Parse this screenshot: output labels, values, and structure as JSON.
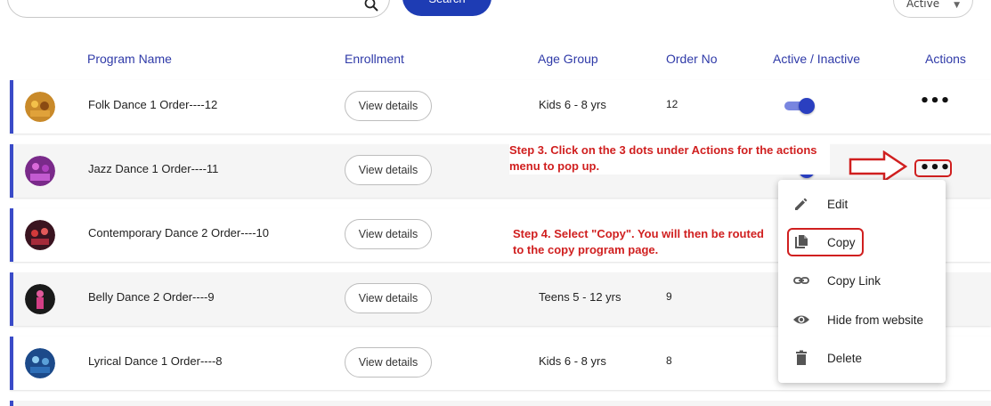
{
  "toolbar": {
    "search_button_label": "Search",
    "status_filter_value": "Active"
  },
  "table": {
    "headers": [
      "Program Name",
      "Enrollment",
      "Age Group",
      "Order No",
      "Active / Inactive",
      "Actions"
    ],
    "view_details_label": "View details",
    "rows": [
      {
        "name": "Folk Dance 1 Order----12",
        "age_group": "Kids 6 - 8 yrs",
        "order_no": "12",
        "active": true
      },
      {
        "name": "Jazz Dance 1 Order----11",
        "age_group": "",
        "order_no": "",
        "active": true
      },
      {
        "name": "Contemporary Dance 2 Order----10",
        "age_group": "",
        "order_no": "",
        "active": true
      },
      {
        "name": "Belly Dance 2 Order----9",
        "age_group": "Teens 5 - 12 yrs",
        "order_no": "9",
        "active": true
      },
      {
        "name": "Lyrical Dance 1 Order----8",
        "age_group": "Kids 6 - 8 yrs",
        "order_no": "8",
        "active": true
      }
    ]
  },
  "actions_menu": {
    "items": [
      {
        "label": "Edit",
        "icon": "pencil-icon"
      },
      {
        "label": "Copy",
        "icon": "copy-file-icon"
      },
      {
        "label": "Copy Link",
        "icon": "link-icon"
      },
      {
        "label": "Hide from website",
        "icon": "eye-icon"
      },
      {
        "label": "Delete",
        "icon": "trash-icon"
      }
    ]
  },
  "annotations": {
    "step3": "Step 3. Click on the 3 dots under Actions for the actions menu to pop up.",
    "step4": "Step 4. Select \"Copy\".  You will then be routed to the copy program page."
  },
  "colors": {
    "accent": "#2f3aa8",
    "annotation": "#d01f1f",
    "toggle_on": "#2a3fc0"
  }
}
